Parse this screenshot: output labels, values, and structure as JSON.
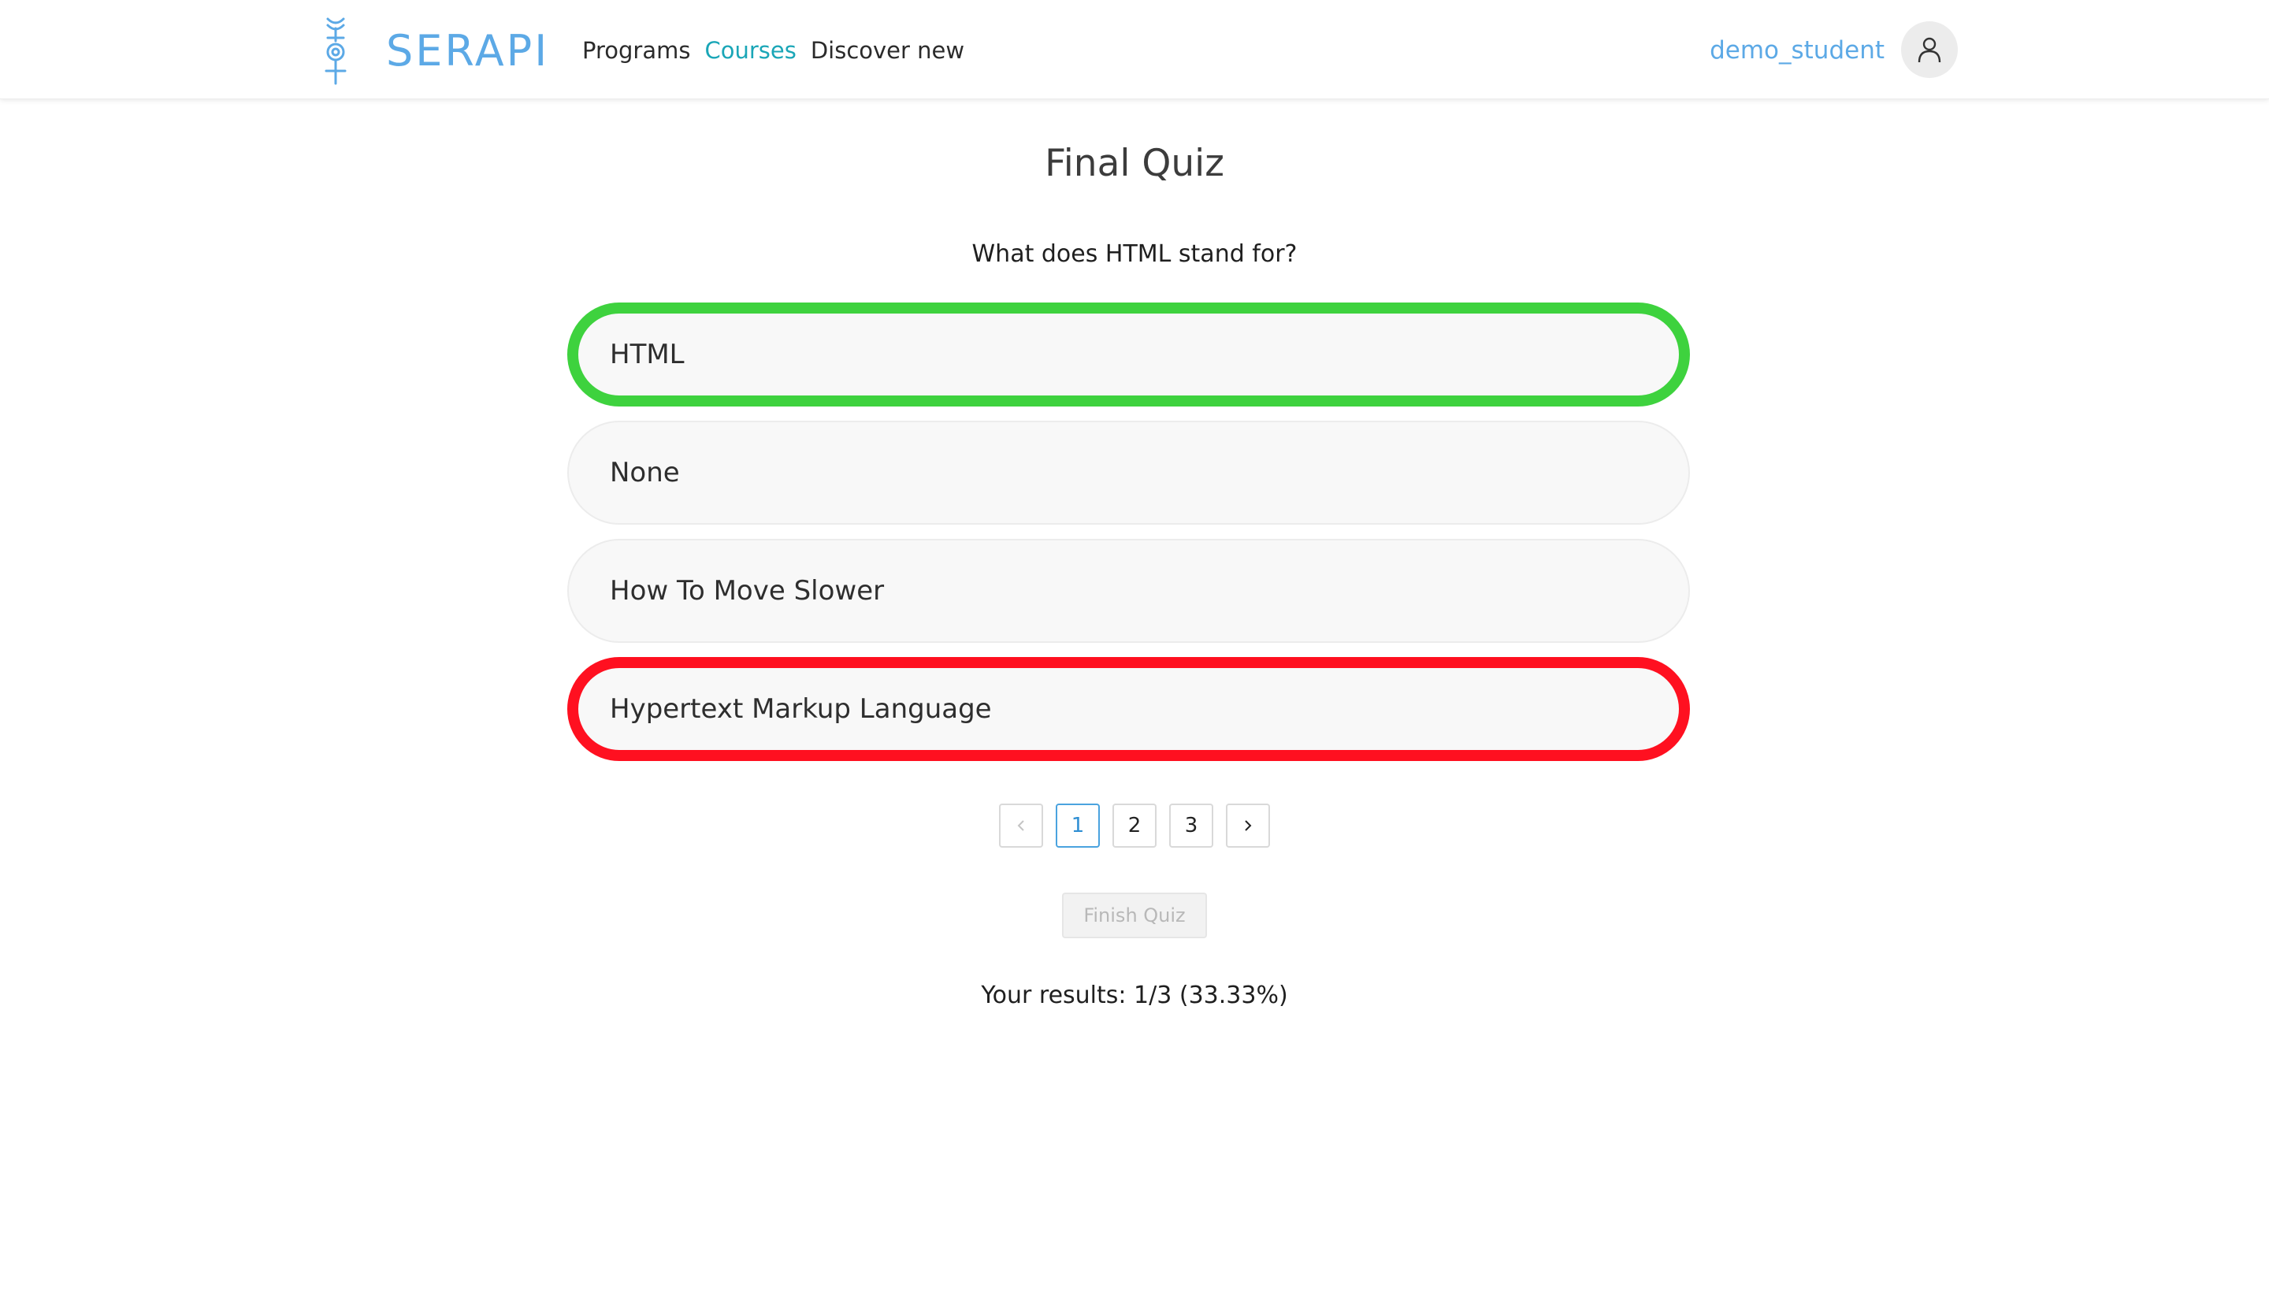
{
  "header": {
    "brand": "SERAPI",
    "logo_icon": "serapi-symbol-icon",
    "nav": [
      {
        "label": "Programs",
        "active": false
      },
      {
        "label": "Courses",
        "active": true
      },
      {
        "label": "Discover new",
        "active": false
      }
    ],
    "username": "demo_student",
    "avatar_icon": "user-icon"
  },
  "quiz": {
    "title": "Final Quiz",
    "question": "What does HTML stand for?",
    "answers": [
      {
        "label": "HTML",
        "state": "correct"
      },
      {
        "label": "None",
        "state": "neutral"
      },
      {
        "label": "How To Move Slower",
        "state": "neutral"
      },
      {
        "label": "Hypertext Markup Language",
        "state": "wrong"
      }
    ]
  },
  "pagination": {
    "prev_icon": "chevron-left-icon",
    "pages": [
      "1",
      "2",
      "3"
    ],
    "current": "1",
    "next_icon": "chevron-right-icon"
  },
  "finish_label": "Finish Quiz",
  "results_text": "Your results: 1/3 (33.33%)",
  "colors": {
    "brand": "#5ca9e6",
    "active_nav": "#1aa6b7",
    "correct_border": "#3ed23e",
    "wrong_border": "#ff1020",
    "answer_bg": "#f8f8f8"
  }
}
